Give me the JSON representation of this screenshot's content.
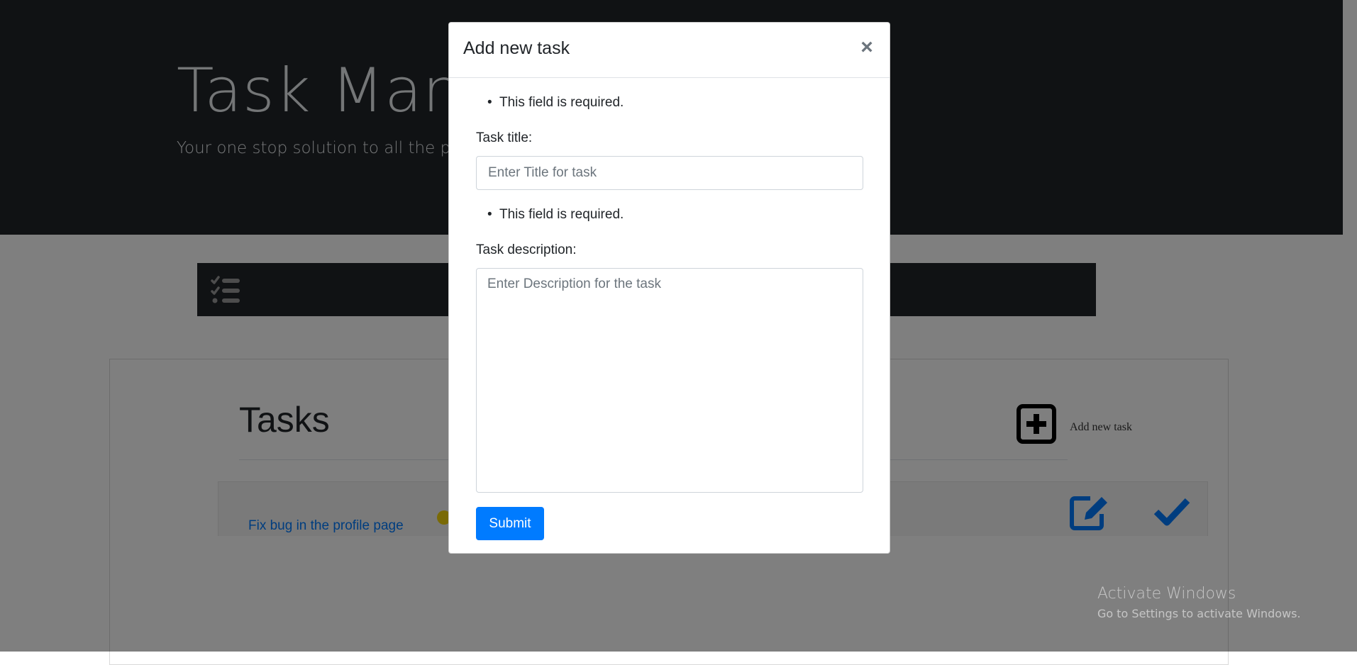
{
  "hero": {
    "title": "Task Manager",
    "subtitle": "Your one stop solution to all the problems"
  },
  "navbar": {
    "toggle_icon": "tasks-list-icon"
  },
  "tasks": {
    "heading": "Tasks",
    "add_label": "Add new task",
    "add_icon": "plus-square-icon",
    "items": [
      {
        "title": "Fix bug in the profile page",
        "priority_color": "#f4d40c",
        "actions": [
          "edit-icon",
          "check-icon"
        ]
      }
    ]
  },
  "modal": {
    "title": "Add new task",
    "close_label": "×",
    "title_field": {
      "error": "This field is required.",
      "label": "Task title:",
      "placeholder": "Enter Title for task",
      "value": ""
    },
    "description_field": {
      "error": "This field is required.",
      "label": "Task description:",
      "placeholder": "Enter Description for the task",
      "value": ""
    },
    "submit_label": "Submit"
  },
  "watermark": {
    "title": "Activate Windows",
    "subtitle": "Go to Settings to activate Windows."
  },
  "colors": {
    "dark": "#212529",
    "primary": "#007bff",
    "priority_medium": "#f4d40c"
  }
}
